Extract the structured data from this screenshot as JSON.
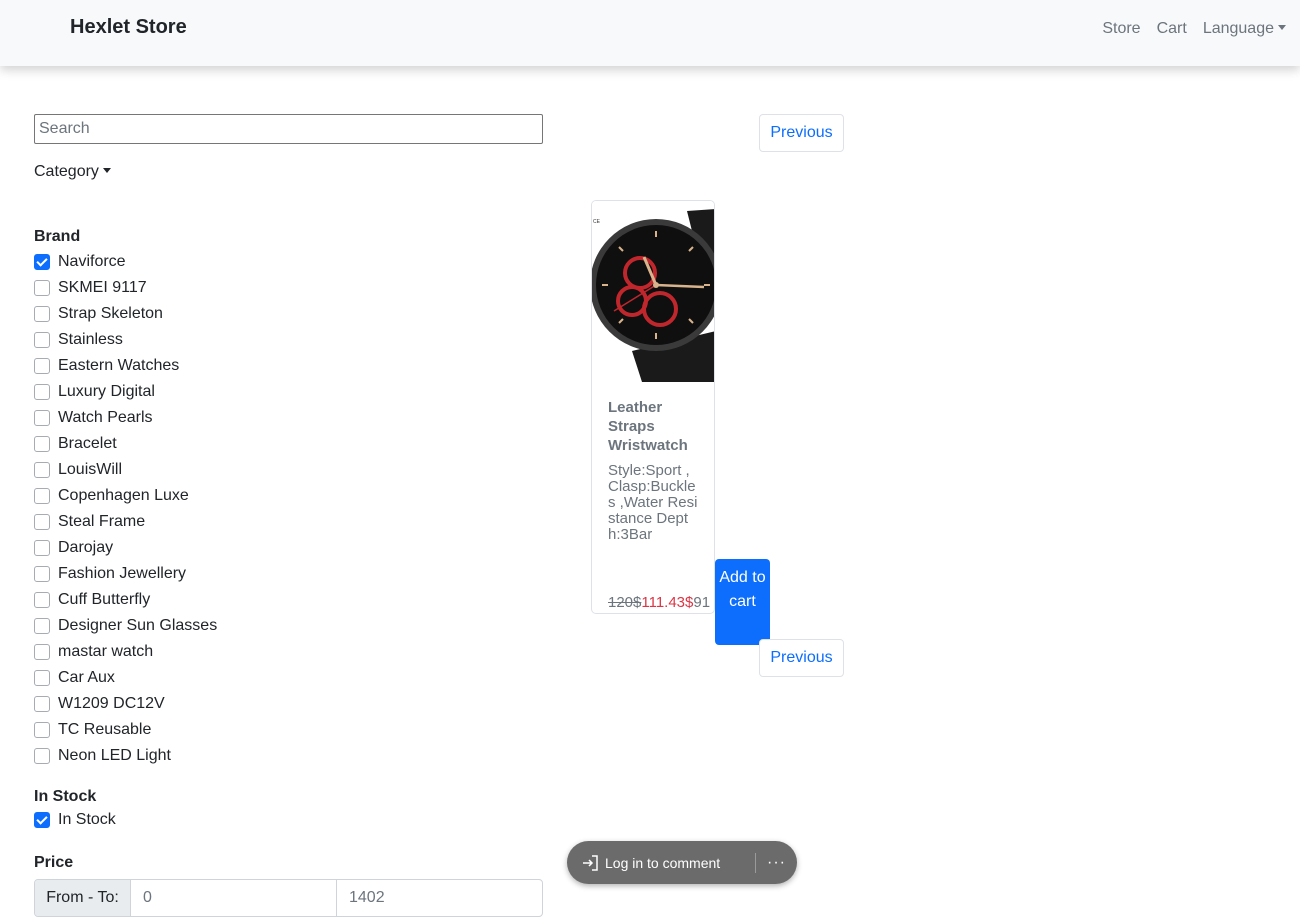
{
  "navbar": {
    "brand": "Hexlet Store",
    "links": [
      "Store",
      "Cart"
    ],
    "language": "Language"
  },
  "filters": {
    "search_placeholder": "Search",
    "category_label": "Category",
    "brand_title": "Brand",
    "brands": [
      {
        "label": "Naviforce",
        "checked": true
      },
      {
        "label": "SKMEI 9117",
        "checked": false
      },
      {
        "label": "Strap Skeleton",
        "checked": false
      },
      {
        "label": "Stainless",
        "checked": false
      },
      {
        "label": "Eastern Watches",
        "checked": false
      },
      {
        "label": "Luxury Digital",
        "checked": false
      },
      {
        "label": "Watch Pearls",
        "checked": false
      },
      {
        "label": "Bracelet",
        "checked": false
      },
      {
        "label": "LouisWill",
        "checked": false
      },
      {
        "label": "Copenhagen Luxe",
        "checked": false
      },
      {
        "label": "Steal Frame",
        "checked": false
      },
      {
        "label": "Darojay",
        "checked": false
      },
      {
        "label": "Fashion Jewellery",
        "checked": false
      },
      {
        "label": "Cuff Butterfly",
        "checked": false
      },
      {
        "label": "Designer Sun Glasses",
        "checked": false
      },
      {
        "label": "mastar watch",
        "checked": false
      },
      {
        "label": "Car Aux",
        "checked": false
      },
      {
        "label": "W1209 DC12V",
        "checked": false
      },
      {
        "label": "TC Reusable",
        "checked": false
      },
      {
        "label": "Neon LED Light",
        "checked": false
      }
    ],
    "stock_title": "In Stock",
    "stock_label": "In Stock",
    "stock_checked": true,
    "price_title": "Price",
    "price_label": "From - To:",
    "price_from": "0",
    "price_to": "1402"
  },
  "pagination": {
    "previous_top": "Previous",
    "previous_bottom": "Previous"
  },
  "product": {
    "title": "Leather Straps Wristwatch",
    "description": "Style:Sport ,Clasp:Buckles ,Water Resistance Depth:3Bar",
    "old_price": "120$",
    "new_price": "111.43$",
    "rest_price": "91",
    "add_to_cart": "Add to cart",
    "image_colors": {
      "dial": "#111111",
      "accent": "#c0272d",
      "bezel": "#3a3a3a"
    }
  },
  "comment_widget": {
    "login_label": "Log in to comment",
    "more_label": "···"
  }
}
